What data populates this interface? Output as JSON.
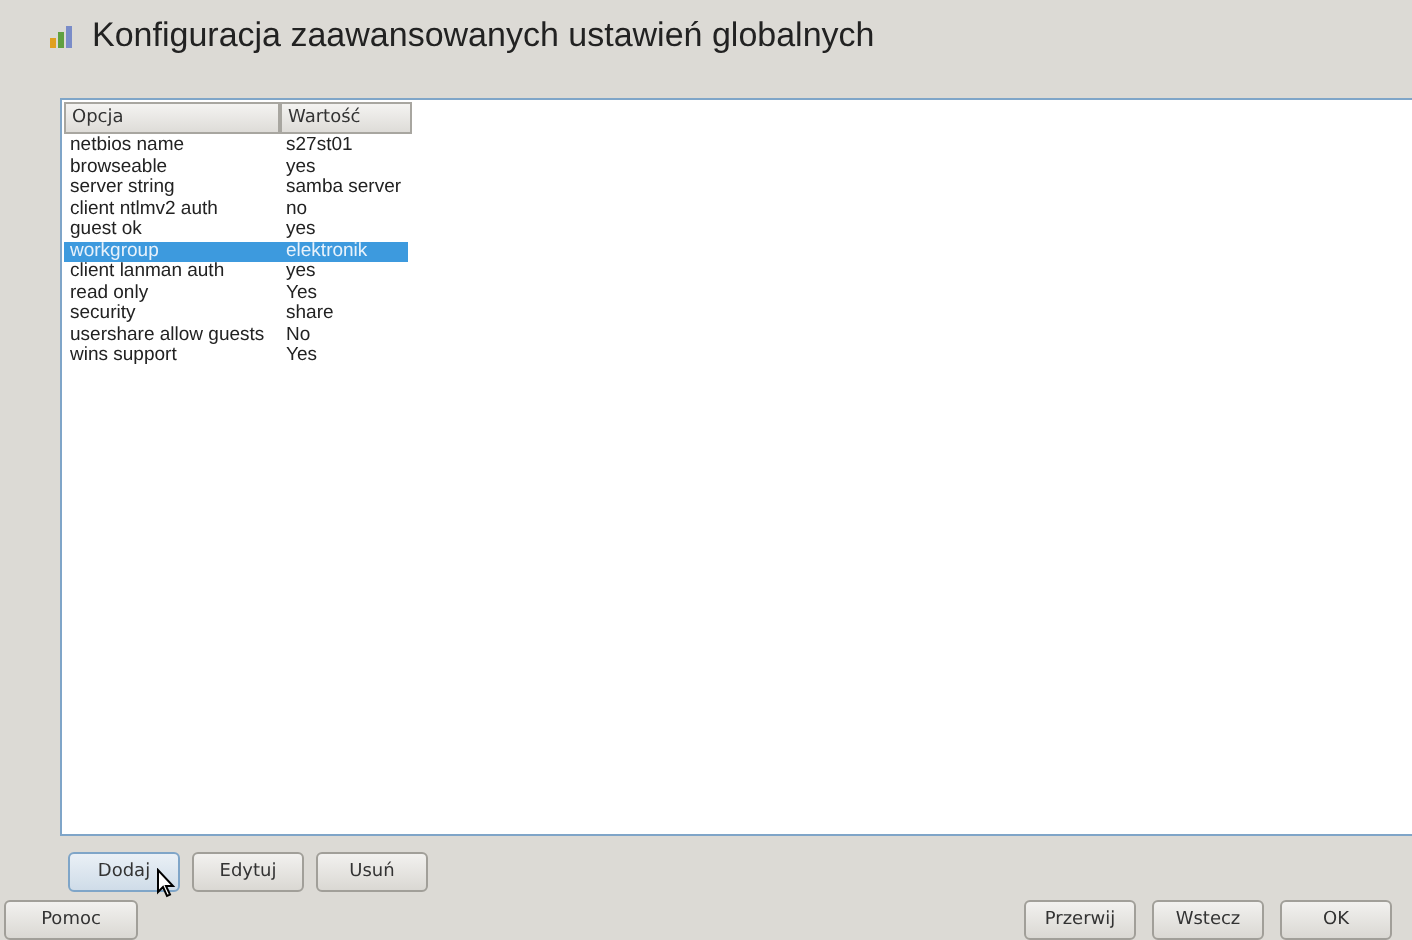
{
  "window": {
    "title": "Konfiguracja zaawansowanych ustawień globalnych"
  },
  "table": {
    "columns": [
      "Opcja",
      "Wartość"
    ],
    "rows": [
      {
        "option": "netbios name",
        "value": "s27st01",
        "selected": false
      },
      {
        "option": "browseable",
        "value": "yes",
        "selected": false
      },
      {
        "option": "server string",
        "value": "samba server",
        "selected": false
      },
      {
        "option": "client ntlmv2 auth",
        "value": "no",
        "selected": false
      },
      {
        "option": "guest ok",
        "value": "yes",
        "selected": false
      },
      {
        "option": "workgroup",
        "value": "elektronik",
        "selected": true
      },
      {
        "option": "client lanman auth",
        "value": "yes",
        "selected": false
      },
      {
        "option": "read only",
        "value": "Yes",
        "selected": false
      },
      {
        "option": "security",
        "value": "share",
        "selected": false
      },
      {
        "option": "usershare allow guests",
        "value": "No",
        "selected": false
      },
      {
        "option": "wins support",
        "value": "Yes",
        "selected": false
      }
    ]
  },
  "table_buttons": [
    {
      "label": "Dodaj",
      "focused": true
    },
    {
      "label": "Edytuj",
      "focused": false
    },
    {
      "label": "Usuń",
      "focused": false
    }
  ],
  "help_button": "Pomoc",
  "nav_buttons": [
    "Przerwij",
    "Wstecz",
    "OK"
  ]
}
